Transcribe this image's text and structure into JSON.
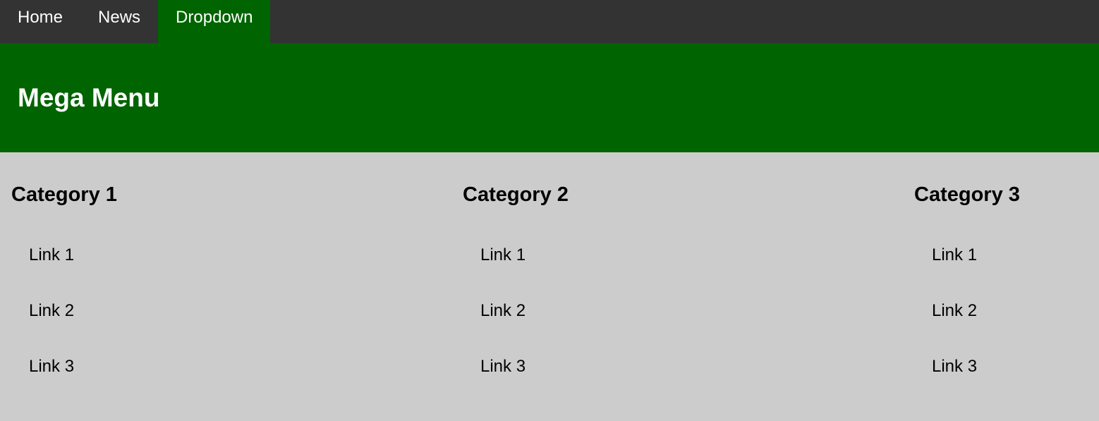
{
  "nav": {
    "items": [
      {
        "label": "Home"
      },
      {
        "label": "News"
      },
      {
        "label": "Dropdown"
      }
    ]
  },
  "header": {
    "title": "Mega Menu"
  },
  "columns": [
    {
      "title": "Category 1",
      "links": [
        "Link 1",
        "Link 2",
        "Link 3"
      ]
    },
    {
      "title": "Category 2",
      "links": [
        "Link 1",
        "Link 2",
        "Link 3"
      ]
    },
    {
      "title": "Category 3",
      "links": [
        "Link 1",
        "Link 2",
        "Link 3"
      ]
    }
  ],
  "colors": {
    "navbar": "#333333",
    "accent": "#006400",
    "content_bg": "#cccccc"
  }
}
